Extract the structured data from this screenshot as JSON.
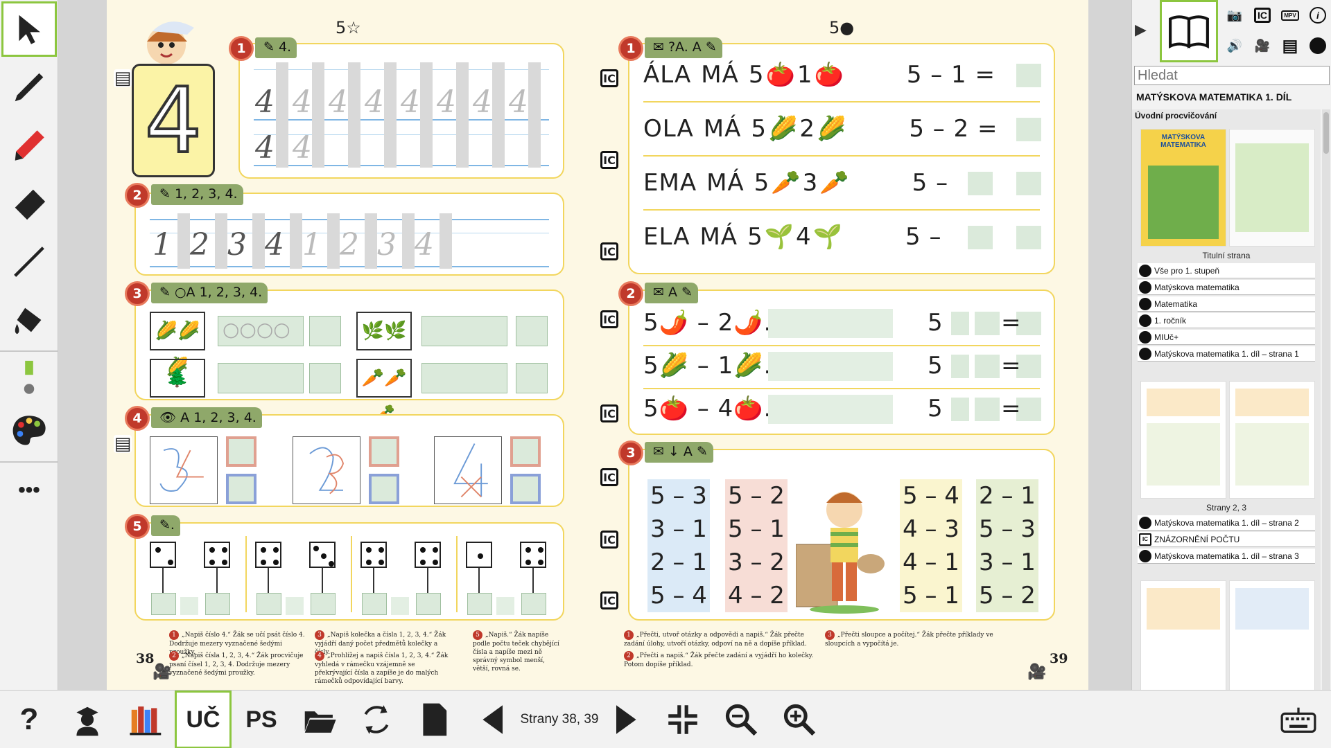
{
  "app": {
    "accent_color": "#8cc63f",
    "page_background": "#fdf8e4",
    "panel_border_color": "#f2d65e",
    "badge_color": "#c0392b"
  },
  "left_toolbar": {
    "tools": [
      {
        "name": "select-tool",
        "icon": "arrow-cursor-icon",
        "active": true
      },
      {
        "name": "pen-tool",
        "icon": "pen-icon"
      },
      {
        "name": "marker-tool",
        "icon": "marker-icon",
        "color": "#e03030"
      },
      {
        "name": "eraser-tool",
        "icon": "eraser-icon"
      },
      {
        "name": "line-tool",
        "icon": "line-icon"
      },
      {
        "name": "fill-tool",
        "icon": "paint-bucket-icon"
      },
      {
        "name": "color-size",
        "icon": "size-indicator-icon",
        "color": "#8cc63f"
      },
      {
        "name": "palette-tool",
        "icon": "palette-icon"
      },
      {
        "name": "more-tool",
        "icon": "more-dots-icon"
      }
    ],
    "more_label": "•••"
  },
  "book": {
    "left_page": {
      "top_mark": "5☆",
      "page_number": "38",
      "tasks": [
        {
          "number": "1",
          "tag": "4."
        },
        {
          "number": "2",
          "tag": "1, 2, 3, 4."
        },
        {
          "number": "3",
          "tag": "A 1, 2, 3, 4."
        },
        {
          "number": "4",
          "tag": "A 1, 2, 3, 4."
        },
        {
          "number": "5",
          "tag": "."
        }
      ],
      "big_digit": "4",
      "task1_row1": "4",
      "task1_row2": "4",
      "task2_digits": [
        "1",
        "2",
        "3",
        "4"
      ],
      "notes": [
        {
          "n": "1",
          "text": "„Napiš číslo 4.“ Žák se učí psát číslo 4. Dodržuje mezery vyznačené šedými proužky."
        },
        {
          "n": "2",
          "text": "„Napiš čísla 1, 2, 3, 4.“ Žák procvičuje psaní čísel 1, 2, 3, 4. Dodržuje mezery vyznačené šedými proužky."
        },
        {
          "n": "3",
          "text": "„Napiš kolečka a čísla 1, 2, 3, 4.“ Žák vyjádří daný počet předmětů kolečky a čísly."
        },
        {
          "n": "4",
          "text": "„Prohlížej a napiš čísla 1, 2, 3, 4.“ Žák vyhledá v rámečku vzájemně se překrývající čísla a zapíše je do malých rámečků odpovídající barvy."
        },
        {
          "n": "5",
          "text": "„Napiš.“ Žák napíše podle počtu teček chybějící čísla a napíše mezi ně správný symbol menší, větší, rovná se."
        }
      ]
    },
    "right_page": {
      "top_mark": "5●",
      "page_number": "39",
      "tasks": [
        {
          "number": "1",
          "tag": "?A. A"
        },
        {
          "number": "2",
          "tag": "A"
        },
        {
          "number": "3",
          "tag": "A"
        }
      ],
      "equations": [
        {
          "name": "ÁLA",
          "verb": "MÁ",
          "a": "5",
          "item": "🍅",
          "b": "1",
          "expr": "5 –  1  ="
        },
        {
          "name": "OLA",
          "verb": "MÁ",
          "a": "5",
          "item": "🌽",
          "b": "2",
          "expr": "5 –  2  ="
        },
        {
          "name": "EMA",
          "verb": "MÁ",
          "a": "5",
          "item": "🥕",
          "b": "3",
          "expr": "5 –"
        },
        {
          "name": "ELA",
          "verb": "MÁ",
          "a": "5",
          "item": "🌱",
          "b": "4",
          "expr": "5 –"
        }
      ],
      "task2_rows": [
        {
          "expr": "5🌶️ – 2🌶️.",
          "right": "5"
        },
        {
          "expr": "5🌽 – 1🌽.",
          "right": "5"
        },
        {
          "expr": "5🍅 – 4🍅.",
          "right": "5"
        }
      ],
      "columns": [
        {
          "color": "#dbeaf7",
          "items": [
            "5 – 3",
            "3 – 1",
            "2 – 1",
            "5 – 4"
          ]
        },
        {
          "color": "#f7ddd6",
          "items": [
            "5 – 2",
            "5 – 1",
            "3 – 2",
            "4 – 2"
          ]
        },
        {
          "color": "#faf5cf",
          "items": [
            "5 – 4",
            "4 – 3",
            "4 – 1",
            "5 – 1"
          ]
        },
        {
          "color": "#e6efd3",
          "items": [
            "2 – 1",
            "5 – 3",
            "3 – 1",
            "5 – 2"
          ]
        }
      ],
      "notes": [
        {
          "n": "1",
          "text": "„Přečti, utvoř otázky a odpovědi a napiš.“ Žák přečte zadání úlohy, utvoří otázky, odpoví na ně a dopíše příklad."
        },
        {
          "n": "2",
          "text": "„Přečti a napiš.“ Žák přečte zadání a vyjádří ho kolečky. Potom dopíše příklad."
        },
        {
          "n": "3",
          "text": "„Přečti sloupce a počítej.“ Žák přečte příklady ve sloupcích a vypočítá je."
        }
      ]
    },
    "ic_label": "IC"
  },
  "right_panel": {
    "search_placeholder": "Hledat",
    "book_title": "MATÝSKOVA MATEMATIKA 1. DÍL",
    "section_title": "Úvodní procvičování",
    "icons": [
      "camera-icon",
      "ic-icon",
      "mpv-icon",
      "info-icon",
      "speaker-icon",
      "video-camera-icon",
      "film-icon",
      "globe-icon"
    ],
    "ic_text": "IC",
    "mpv_text": "MPV",
    "info_text": "i",
    "cover_title": "MATÝSKOVA MATEMATIKA",
    "groups": [
      {
        "caption": "Titulní strana",
        "items": [
          {
            "type": "link",
            "label": "Vše pro 1. stupeň"
          },
          {
            "type": "link",
            "label": "Matýskova matematika"
          },
          {
            "type": "link",
            "label": "Matematika"
          },
          {
            "type": "link",
            "label": "1. ročník"
          },
          {
            "type": "link",
            "label": "MIUč+"
          },
          {
            "type": "link",
            "label": "Matýskova matematika 1. díl – strana 1"
          }
        ]
      },
      {
        "caption": "Strany 2, 3",
        "items": [
          {
            "type": "link",
            "label": "Matýskova matematika 1. díl – strana 2"
          },
          {
            "type": "ic",
            "label": "ZNÁZORNĚNÍ POČTU"
          },
          {
            "type": "link",
            "label": "Matýskova matematika 1. díl – strana 3"
          }
        ]
      }
    ]
  },
  "bottom_toolbar": {
    "help_label": "?",
    "uc_label": "UČ",
    "ps_label": "PS",
    "pages_label": "Strany 38, 39"
  }
}
